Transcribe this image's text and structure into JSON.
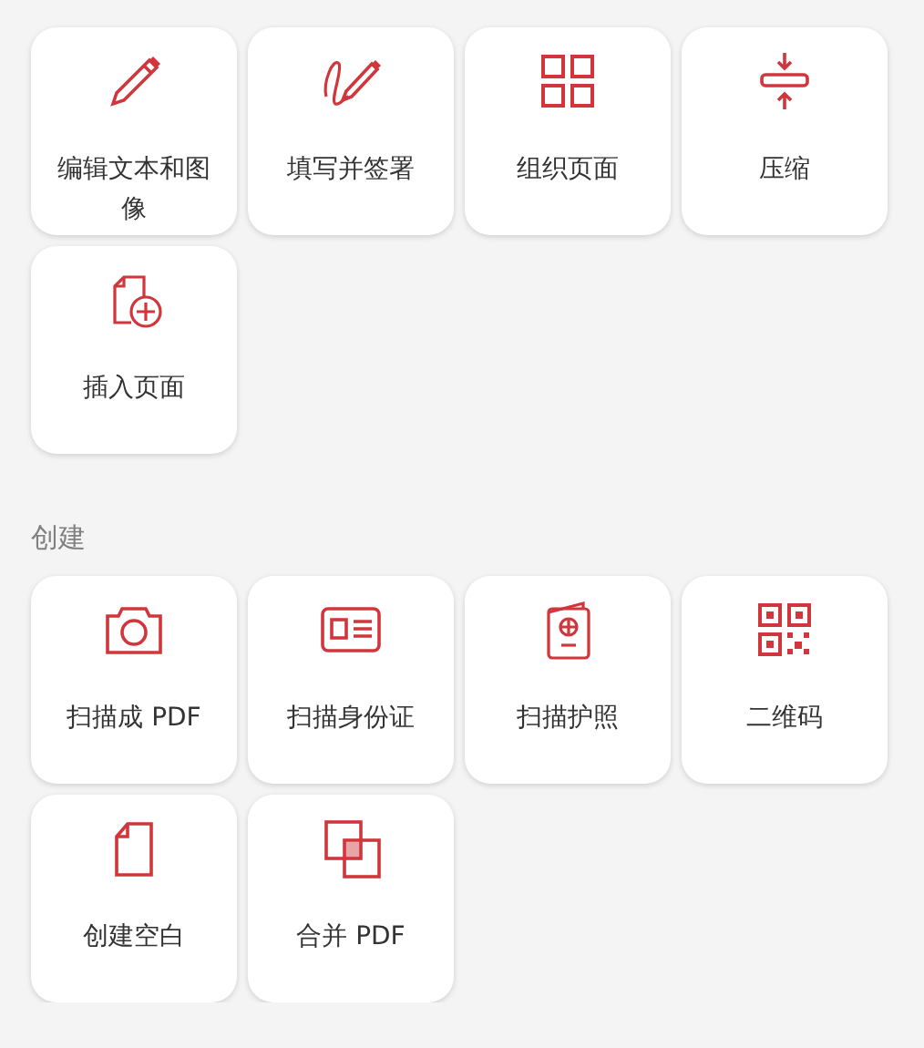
{
  "sections": [
    {
      "tools": [
        {
          "label": "编辑文本和图像",
          "kind": "pencil"
        },
        {
          "label": "填写并签署",
          "kind": "signature"
        },
        {
          "label": "组织页面",
          "kind": "grid"
        },
        {
          "label": "压缩",
          "kind": "compress"
        },
        {
          "label": "插入页面",
          "kind": "insert"
        }
      ]
    },
    {
      "title": "创建",
      "tools": [
        {
          "label": "扫描成 PDF",
          "kind": "camera"
        },
        {
          "label": "扫描身份证",
          "kind": "idcard"
        },
        {
          "label": "扫描护照",
          "kind": "passport"
        },
        {
          "label": "二维码",
          "kind": "qr"
        },
        {
          "label": "创建空白",
          "kind": "page"
        },
        {
          "label": "合并 PDF",
          "kind": "merge"
        }
      ]
    }
  ]
}
